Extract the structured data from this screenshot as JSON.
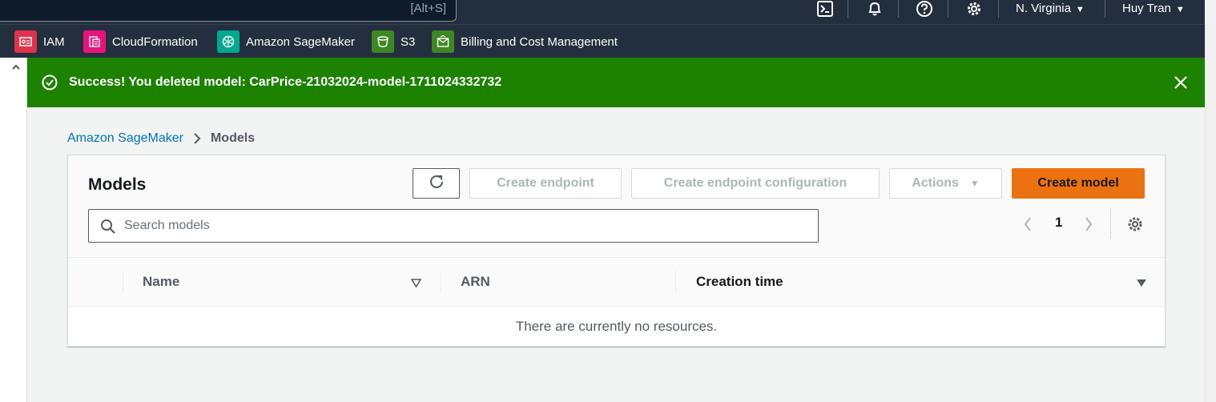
{
  "topnav": {
    "search_hint": "[Alt+S]",
    "region": "N. Virginia",
    "user": "Huy Tran"
  },
  "favorites": [
    {
      "label": "IAM",
      "color": "#dd344c",
      "icon": "iam-icon"
    },
    {
      "label": "CloudFormation",
      "color": "#e7157b",
      "icon": "cloudformation-icon"
    },
    {
      "label": "Amazon SageMaker",
      "color": "#01a88d",
      "icon": "sagemaker-icon"
    },
    {
      "label": "S3",
      "color": "#3f8624",
      "icon": "s3-bucket-icon"
    },
    {
      "label": "Billing and Cost Management",
      "color": "#3f8624",
      "icon": "billing-icon"
    }
  ],
  "flash": {
    "message": "Success! You deleted model: CarPrice-21032024-model-1711024332732",
    "color": "#1d8102"
  },
  "breadcrumb": {
    "root": "Amazon SageMaker",
    "current": "Models"
  },
  "panel": {
    "title": "Models",
    "buttons": {
      "create_endpoint": "Create endpoint",
      "create_endpoint_config": "Create endpoint configuration",
      "actions": "Actions",
      "create_model": "Create model"
    },
    "search_placeholder": "Search models",
    "page": "1",
    "columns": [
      "Name",
      "ARN",
      "Creation time"
    ],
    "empty_text": "There are currently no resources."
  },
  "accent_color": "#ec7211",
  "link_color": "#0073bb"
}
